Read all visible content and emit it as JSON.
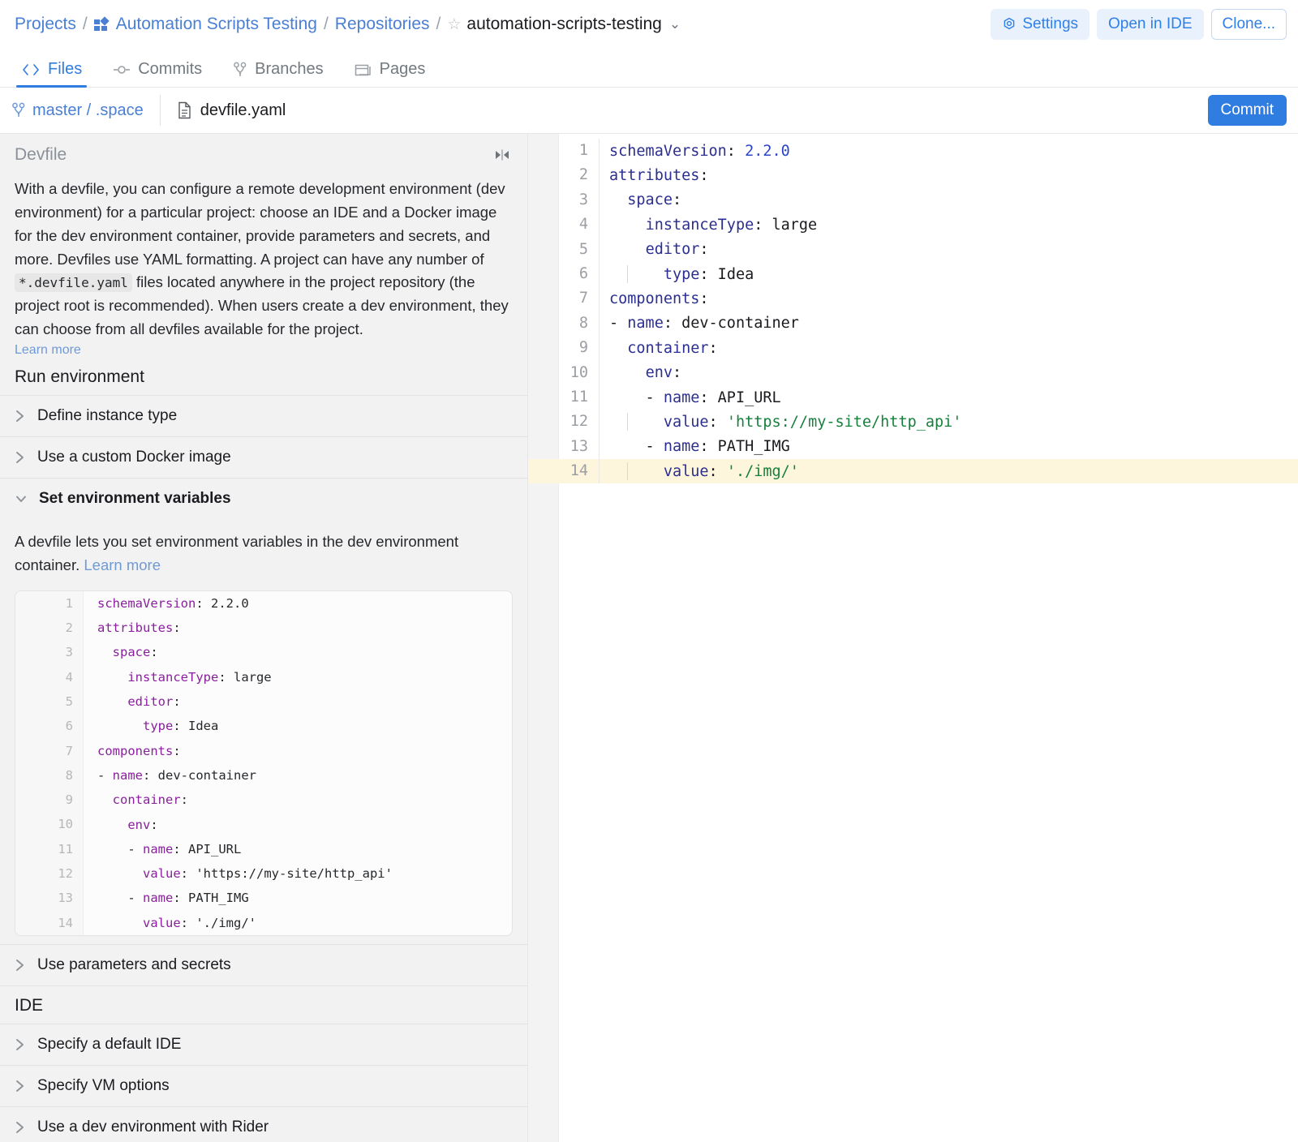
{
  "breadcrumb": {
    "projects": "Projects",
    "project_name": "Automation Scripts Testing",
    "repositories": "Repositories",
    "repo_name": "automation-scripts-testing",
    "separator": "/",
    "star_icon": "star-outline-icon",
    "project_icon": "project-grid-icon",
    "chevron_icon": "chevron-down-icon"
  },
  "top_actions": {
    "settings": "Settings",
    "settings_icon": "gear-icon",
    "open_in_ide": "Open in IDE",
    "clone": "Clone..."
  },
  "tabs": [
    {
      "label": "Files",
      "icon": "code-brackets-icon",
      "active": true
    },
    {
      "label": "Commits",
      "icon": "commit-node-icon",
      "active": false
    },
    {
      "label": "Branches",
      "icon": "branch-icon",
      "active": false
    },
    {
      "label": "Pages",
      "icon": "pages-window-icon",
      "active": false
    }
  ],
  "pathbar": {
    "branch": "master / .space",
    "branch_icon": "branch-icon",
    "file": "devfile.yaml",
    "file_icon": "file-document-icon",
    "commit_label": "Commit"
  },
  "sidebar": {
    "title": "Devfile",
    "collapse_icon": "collapse-panel-icon",
    "intro_a": "With a devfile, you can configure a remote development environment (dev environment) for a particular project: choose an IDE and a Docker image for the dev environment container, provide parameters and secrets, and more. Devfiles use YAML formatting. A project can have any number of ",
    "intro_code": "*.devfile.yaml",
    "intro_b": " files located anywhere in the project repository (the project root is recommended). When users create a dev environment, they can choose from all devfiles available for the project.",
    "learn_more": "Learn more",
    "section_run": "Run environment",
    "section_ide": "IDE",
    "acc_define_instance": "Define instance type",
    "acc_docker_image": "Use a custom Docker image",
    "acc_env_vars": "Set environment variables",
    "acc_env_vars_desc_a": "A devfile lets you set environment variables in the dev environment container. ",
    "acc_env_vars_desc_link": "Learn more",
    "acc_params_secrets": "Use parameters and secrets",
    "acc_default_ide": "Specify a default IDE",
    "acc_vm_options": "Specify VM options",
    "acc_rider": "Use a dev environment with Rider",
    "chevron_right_icon": "chevron-right-icon",
    "chevron_down_icon": "chevron-down-icon"
  },
  "snippet_lines": [
    {
      "n": "1",
      "indent": 0,
      "key": "schemaVersion",
      "value": "2.2.0",
      "dash": false,
      "quoted": false
    },
    {
      "n": "2",
      "indent": 0,
      "key": "attributes",
      "value": "",
      "dash": false,
      "quoted": false
    },
    {
      "n": "3",
      "indent": 1,
      "key": "space",
      "value": "",
      "dash": false,
      "quoted": false
    },
    {
      "n": "4",
      "indent": 2,
      "key": "instanceType",
      "value": "large",
      "dash": false,
      "quoted": false
    },
    {
      "n": "5",
      "indent": 2,
      "key": "editor",
      "value": "",
      "dash": false,
      "quoted": false
    },
    {
      "n": "6",
      "indent": 3,
      "key": "type",
      "value": "Idea",
      "dash": false,
      "quoted": false
    },
    {
      "n": "7",
      "indent": 0,
      "key": "components",
      "value": "",
      "dash": false,
      "quoted": false
    },
    {
      "n": "8",
      "indent": 0,
      "key": "name",
      "value": "dev-container",
      "dash": true,
      "quoted": false
    },
    {
      "n": "9",
      "indent": 1,
      "key": "container",
      "value": "",
      "dash": false,
      "quoted": false
    },
    {
      "n": "10",
      "indent": 2,
      "key": "env",
      "value": "",
      "dash": false,
      "quoted": false
    },
    {
      "n": "11",
      "indent": 2,
      "key": "name",
      "value": "API_URL",
      "dash": true,
      "quoted": false
    },
    {
      "n": "12",
      "indent": 3,
      "key": "value",
      "value": "'https://my-site/http_api'",
      "dash": false,
      "quoted": true
    },
    {
      "n": "13",
      "indent": 2,
      "key": "name",
      "value": "PATH_IMG",
      "dash": true,
      "quoted": false
    },
    {
      "n": "14",
      "indent": 3,
      "key": "value",
      "value": "'./img/'",
      "dash": false,
      "quoted": true
    }
  ],
  "editor_lines": [
    {
      "n": "1",
      "indent": 0,
      "key": "schemaVersion",
      "value": "2.2.0",
      "dash": false,
      "type": "num",
      "guide": false,
      "hl": false
    },
    {
      "n": "2",
      "indent": 0,
      "key": "attributes",
      "value": "",
      "dash": false,
      "type": "none",
      "guide": false,
      "hl": false
    },
    {
      "n": "3",
      "indent": 1,
      "key": "space",
      "value": "",
      "dash": false,
      "type": "none",
      "guide": false,
      "hl": false
    },
    {
      "n": "4",
      "indent": 2,
      "key": "instanceType",
      "value": "large",
      "dash": false,
      "type": "plain",
      "guide": false,
      "hl": false
    },
    {
      "n": "5",
      "indent": 2,
      "key": "editor",
      "value": "",
      "dash": false,
      "type": "none",
      "guide": false,
      "hl": false
    },
    {
      "n": "6",
      "indent": 3,
      "key": "type",
      "value": "Idea",
      "dash": false,
      "type": "plain",
      "guide": true,
      "hl": false
    },
    {
      "n": "7",
      "indent": 0,
      "key": "components",
      "value": "",
      "dash": false,
      "type": "none",
      "guide": false,
      "hl": false
    },
    {
      "n": "8",
      "indent": 0,
      "key": "name",
      "value": "dev-container",
      "dash": true,
      "type": "plain",
      "guide": false,
      "hl": false
    },
    {
      "n": "9",
      "indent": 1,
      "key": "container",
      "value": "",
      "dash": false,
      "type": "none",
      "guide": false,
      "hl": false
    },
    {
      "n": "10",
      "indent": 2,
      "key": "env",
      "value": "",
      "dash": false,
      "type": "none",
      "guide": false,
      "hl": false
    },
    {
      "n": "11",
      "indent": 2,
      "key": "name",
      "value": "API_URL",
      "dash": true,
      "type": "plain",
      "guide": false,
      "hl": false
    },
    {
      "n": "12",
      "indent": 3,
      "key": "value",
      "value": "'https://my-site/http_api'",
      "dash": false,
      "type": "str",
      "guide": true,
      "hl": false
    },
    {
      "n": "13",
      "indent": 2,
      "key": "name",
      "value": "PATH_IMG",
      "dash": true,
      "type": "plain",
      "guide": false,
      "hl": false
    },
    {
      "n": "14",
      "indent": 3,
      "key": "value",
      "value": "'./img/'",
      "dash": false,
      "type": "str",
      "guide": true,
      "hl": true
    }
  ],
  "colors": {
    "accent_blue": "#2f7de1",
    "link_blue": "#4a7fd4",
    "sidebar_bg": "#f2f2f3",
    "highlight_line": "#fdf6dd",
    "yaml_key_editor": "#2b2f8f",
    "yaml_key_snippet": "#8a1f9e",
    "yaml_string": "#17803d",
    "yaml_number": "#2b45c8"
  }
}
